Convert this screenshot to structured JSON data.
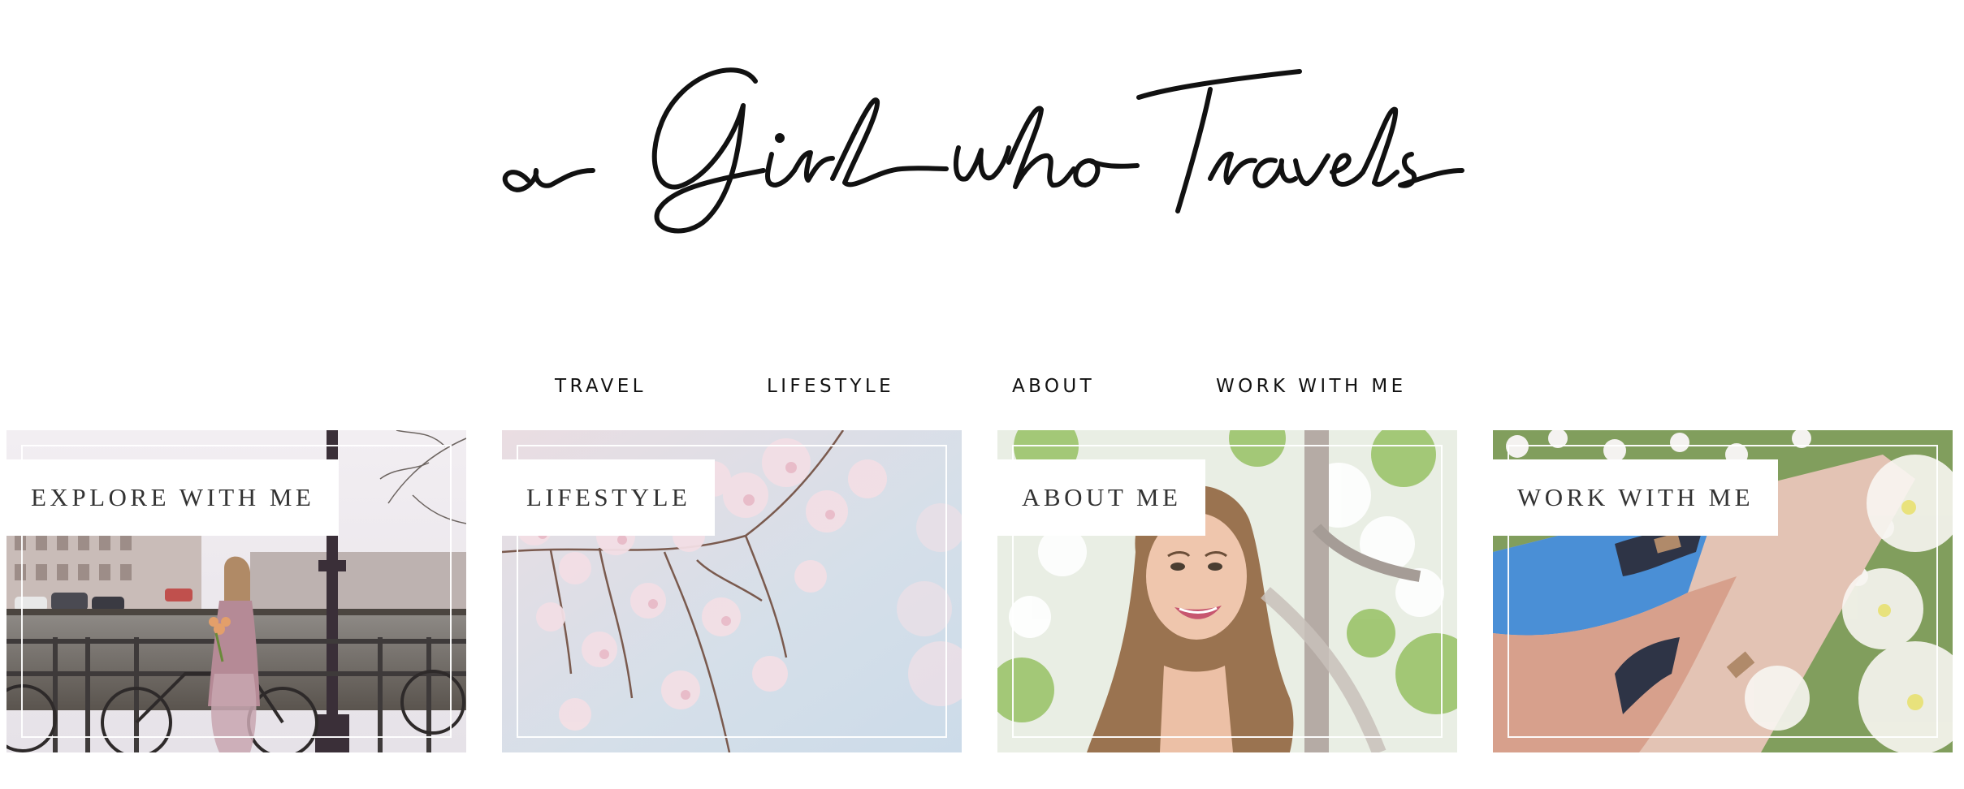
{
  "site": {
    "logo_text": "a Girl who Travels"
  },
  "nav": {
    "items": [
      {
        "label": "TRAVEL"
      },
      {
        "label": "LIFESTYLE"
      },
      {
        "label": "ABOUT"
      },
      {
        "label": "WORK WITH ME"
      }
    ]
  },
  "cards": [
    {
      "label": "EXPLORE WITH ME",
      "photo": "amsterdam-canal-bicycle"
    },
    {
      "label": "LIFESTYLE",
      "photo": "cherry-blossom-branches"
    },
    {
      "label": "ABOUT ME",
      "photo": "smiling-woman-portrait"
    },
    {
      "label": "WORK WITH ME",
      "photo": "deck-chair-in-blossoms"
    }
  ],
  "colors": {
    "text": "#111111",
    "card_label": "#333333",
    "background": "#ffffff"
  }
}
